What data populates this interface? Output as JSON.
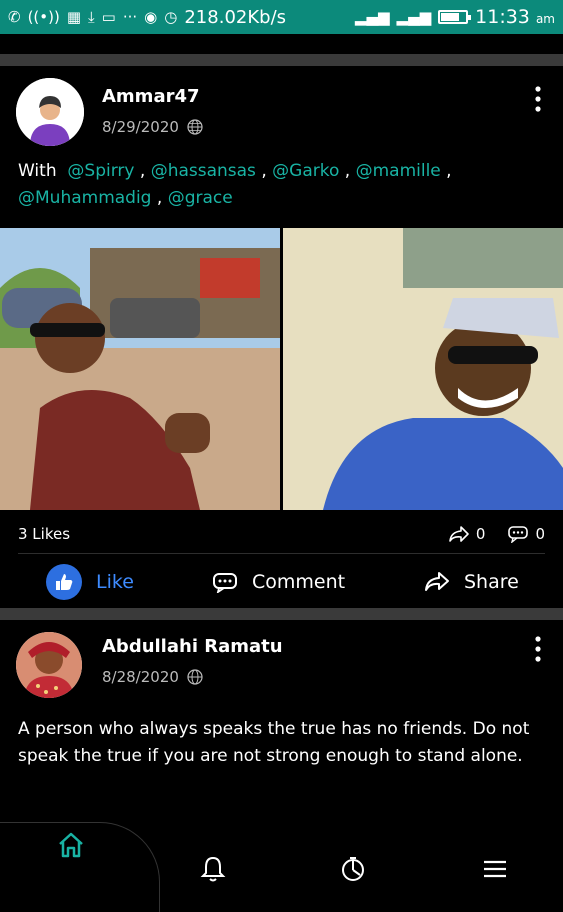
{
  "status_bar": {
    "speed": "218.02Kb/s",
    "time": "11:33",
    "ampm": "am",
    "icons": [
      "whatsapp-icon",
      "hotspot-icon",
      "qr-icon",
      "download-icon",
      "laptop-icon",
      "more-icon",
      "wifi-icon",
      "alarm-icon",
      "signal-icon",
      "signal-icon",
      "battery-icon"
    ]
  },
  "posts": [
    {
      "author": "Ammar47",
      "date": "8/29/2020",
      "text_prefix": "With",
      "mentions": [
        "@Spirry",
        "@hassansas",
        "@Garko",
        "@mamille",
        "@Muhammadig",
        "@grace"
      ],
      "likes_text": "3 Likes",
      "shares": "0",
      "comments": "0",
      "actions": {
        "like": "Like",
        "comment": "Comment",
        "share": "Share"
      }
    },
    {
      "author": "Abdullahi Ramatu",
      "date": "8/28/2020",
      "text": "A person who always speaks the true has no friends. Do not speak the true if you are not strong enough to stand alone."
    }
  ],
  "bottom_nav": {
    "items": [
      "home-icon",
      "bell-icon",
      "activity-icon",
      "menu-icon"
    ]
  },
  "colors": {
    "status_bar": "#0c8a7b",
    "mention": "#19b3a4",
    "like": "#2d6fe0",
    "home_active": "#19b3a4"
  }
}
